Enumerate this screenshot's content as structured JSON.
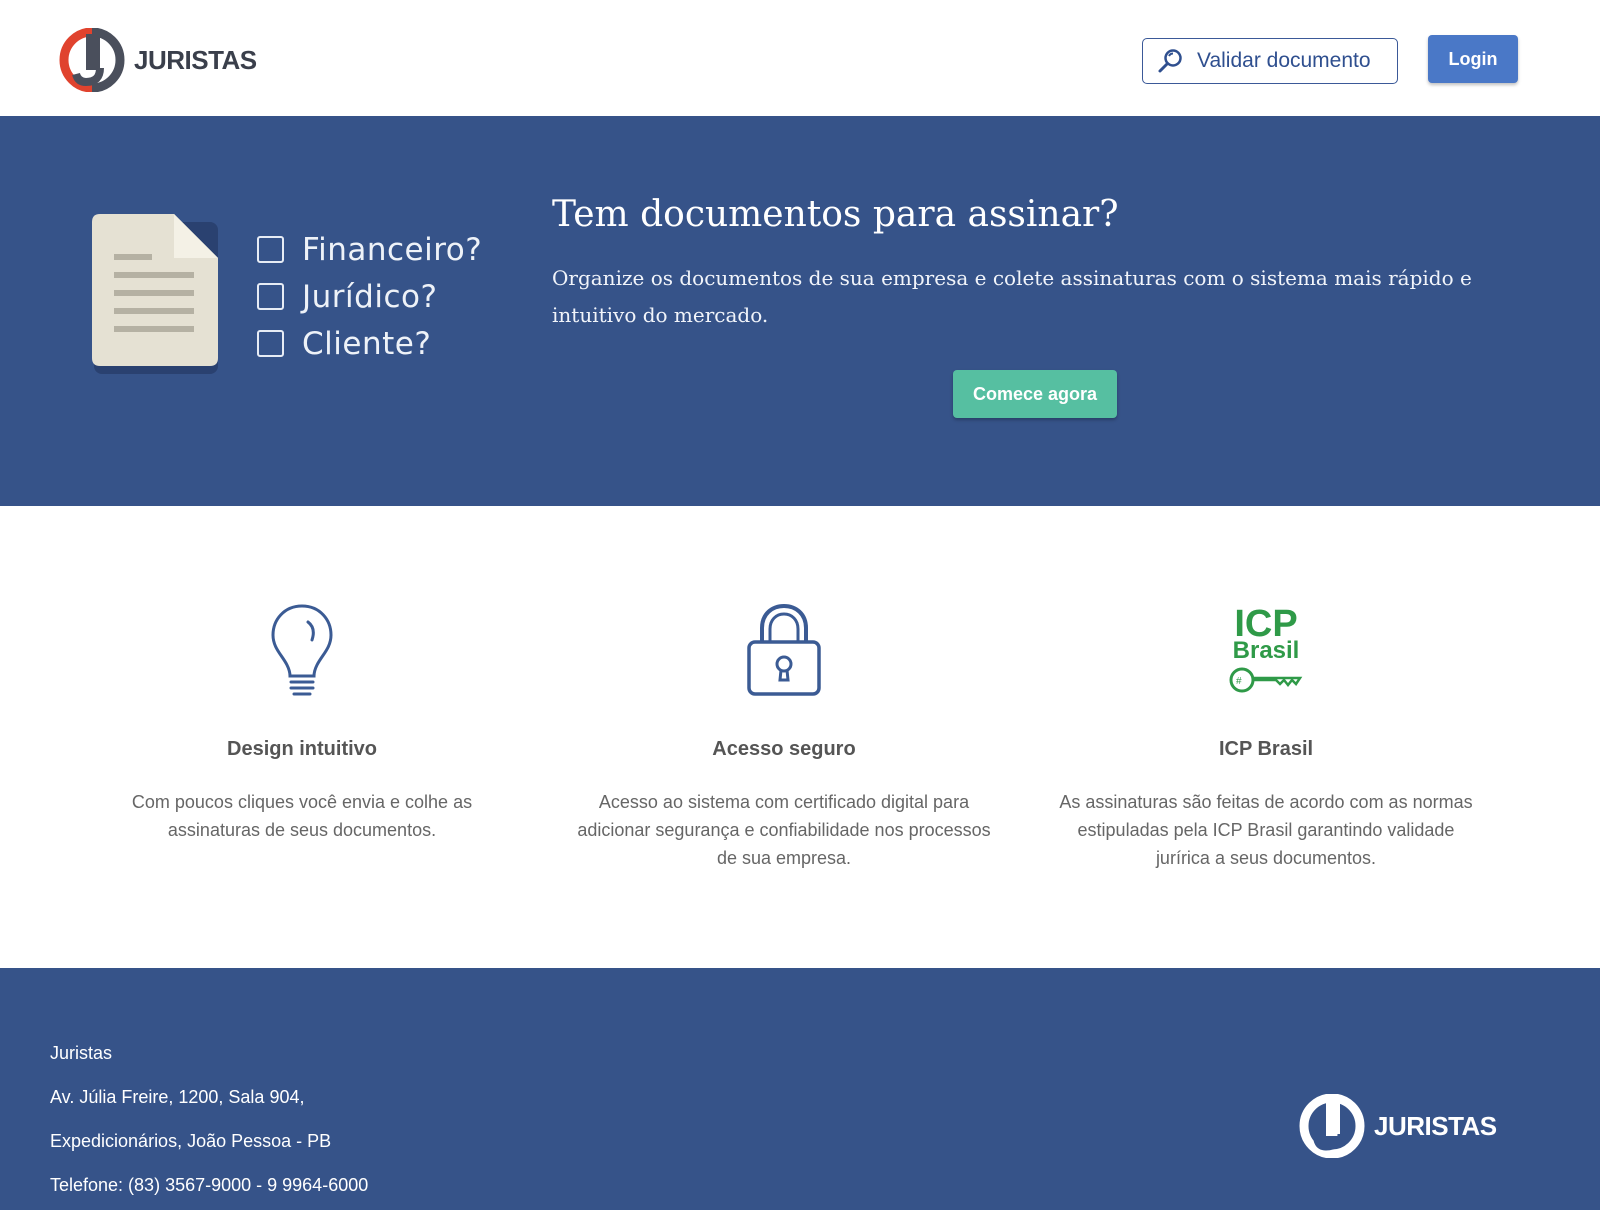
{
  "header": {
    "logo_text": "JURISTAS",
    "validate_label": "Validar documento",
    "login_label": "Login"
  },
  "hero": {
    "checklist": [
      "Financeiro?",
      "Jurídico?",
      "Cliente?"
    ],
    "title": "Tem documentos para assinar?",
    "description": "Organize os documentos de sua empresa e colete assinaturas com o sistema mais rápido e intuitivo do mercado.",
    "cta_label": "Comece agora"
  },
  "features": [
    {
      "icon": "lightbulb-icon",
      "title": "Design intuitivo",
      "text": "Com poucos cliques você envia e colhe as assinaturas de seus documentos."
    },
    {
      "icon": "padlock-icon",
      "title": "Acesso seguro",
      "text": "Acesso ao sistema com certificado digital para adicionar segurança e confiabilidade nos processos de sua empresa."
    },
    {
      "icon": "icp-brasil-icon",
      "title": "ICP Brasil",
      "text": "As assinaturas são feitas de acordo com as normas estipuladas pela ICP Brasil garantindo validade jurírica a seus documentos.",
      "logo_line1": "ICP",
      "logo_line2": "Brasil"
    }
  ],
  "footer": {
    "company": "Juristas",
    "address_line1": "Av. Júlia Freire, 1200, Sala 904,",
    "address_line2": "Expedicionários, João Pessoa - PB",
    "phone": "Telefone: (83) 3567-9000 - 9 9964-6000",
    "logo_text": "JURISTAS"
  },
  "colors": {
    "primary_blue": "#365389",
    "button_blue": "#4a78c7",
    "cta_green": "#56bfa1",
    "logo_red": "#e0432e",
    "icp_green": "#2f9a48"
  }
}
